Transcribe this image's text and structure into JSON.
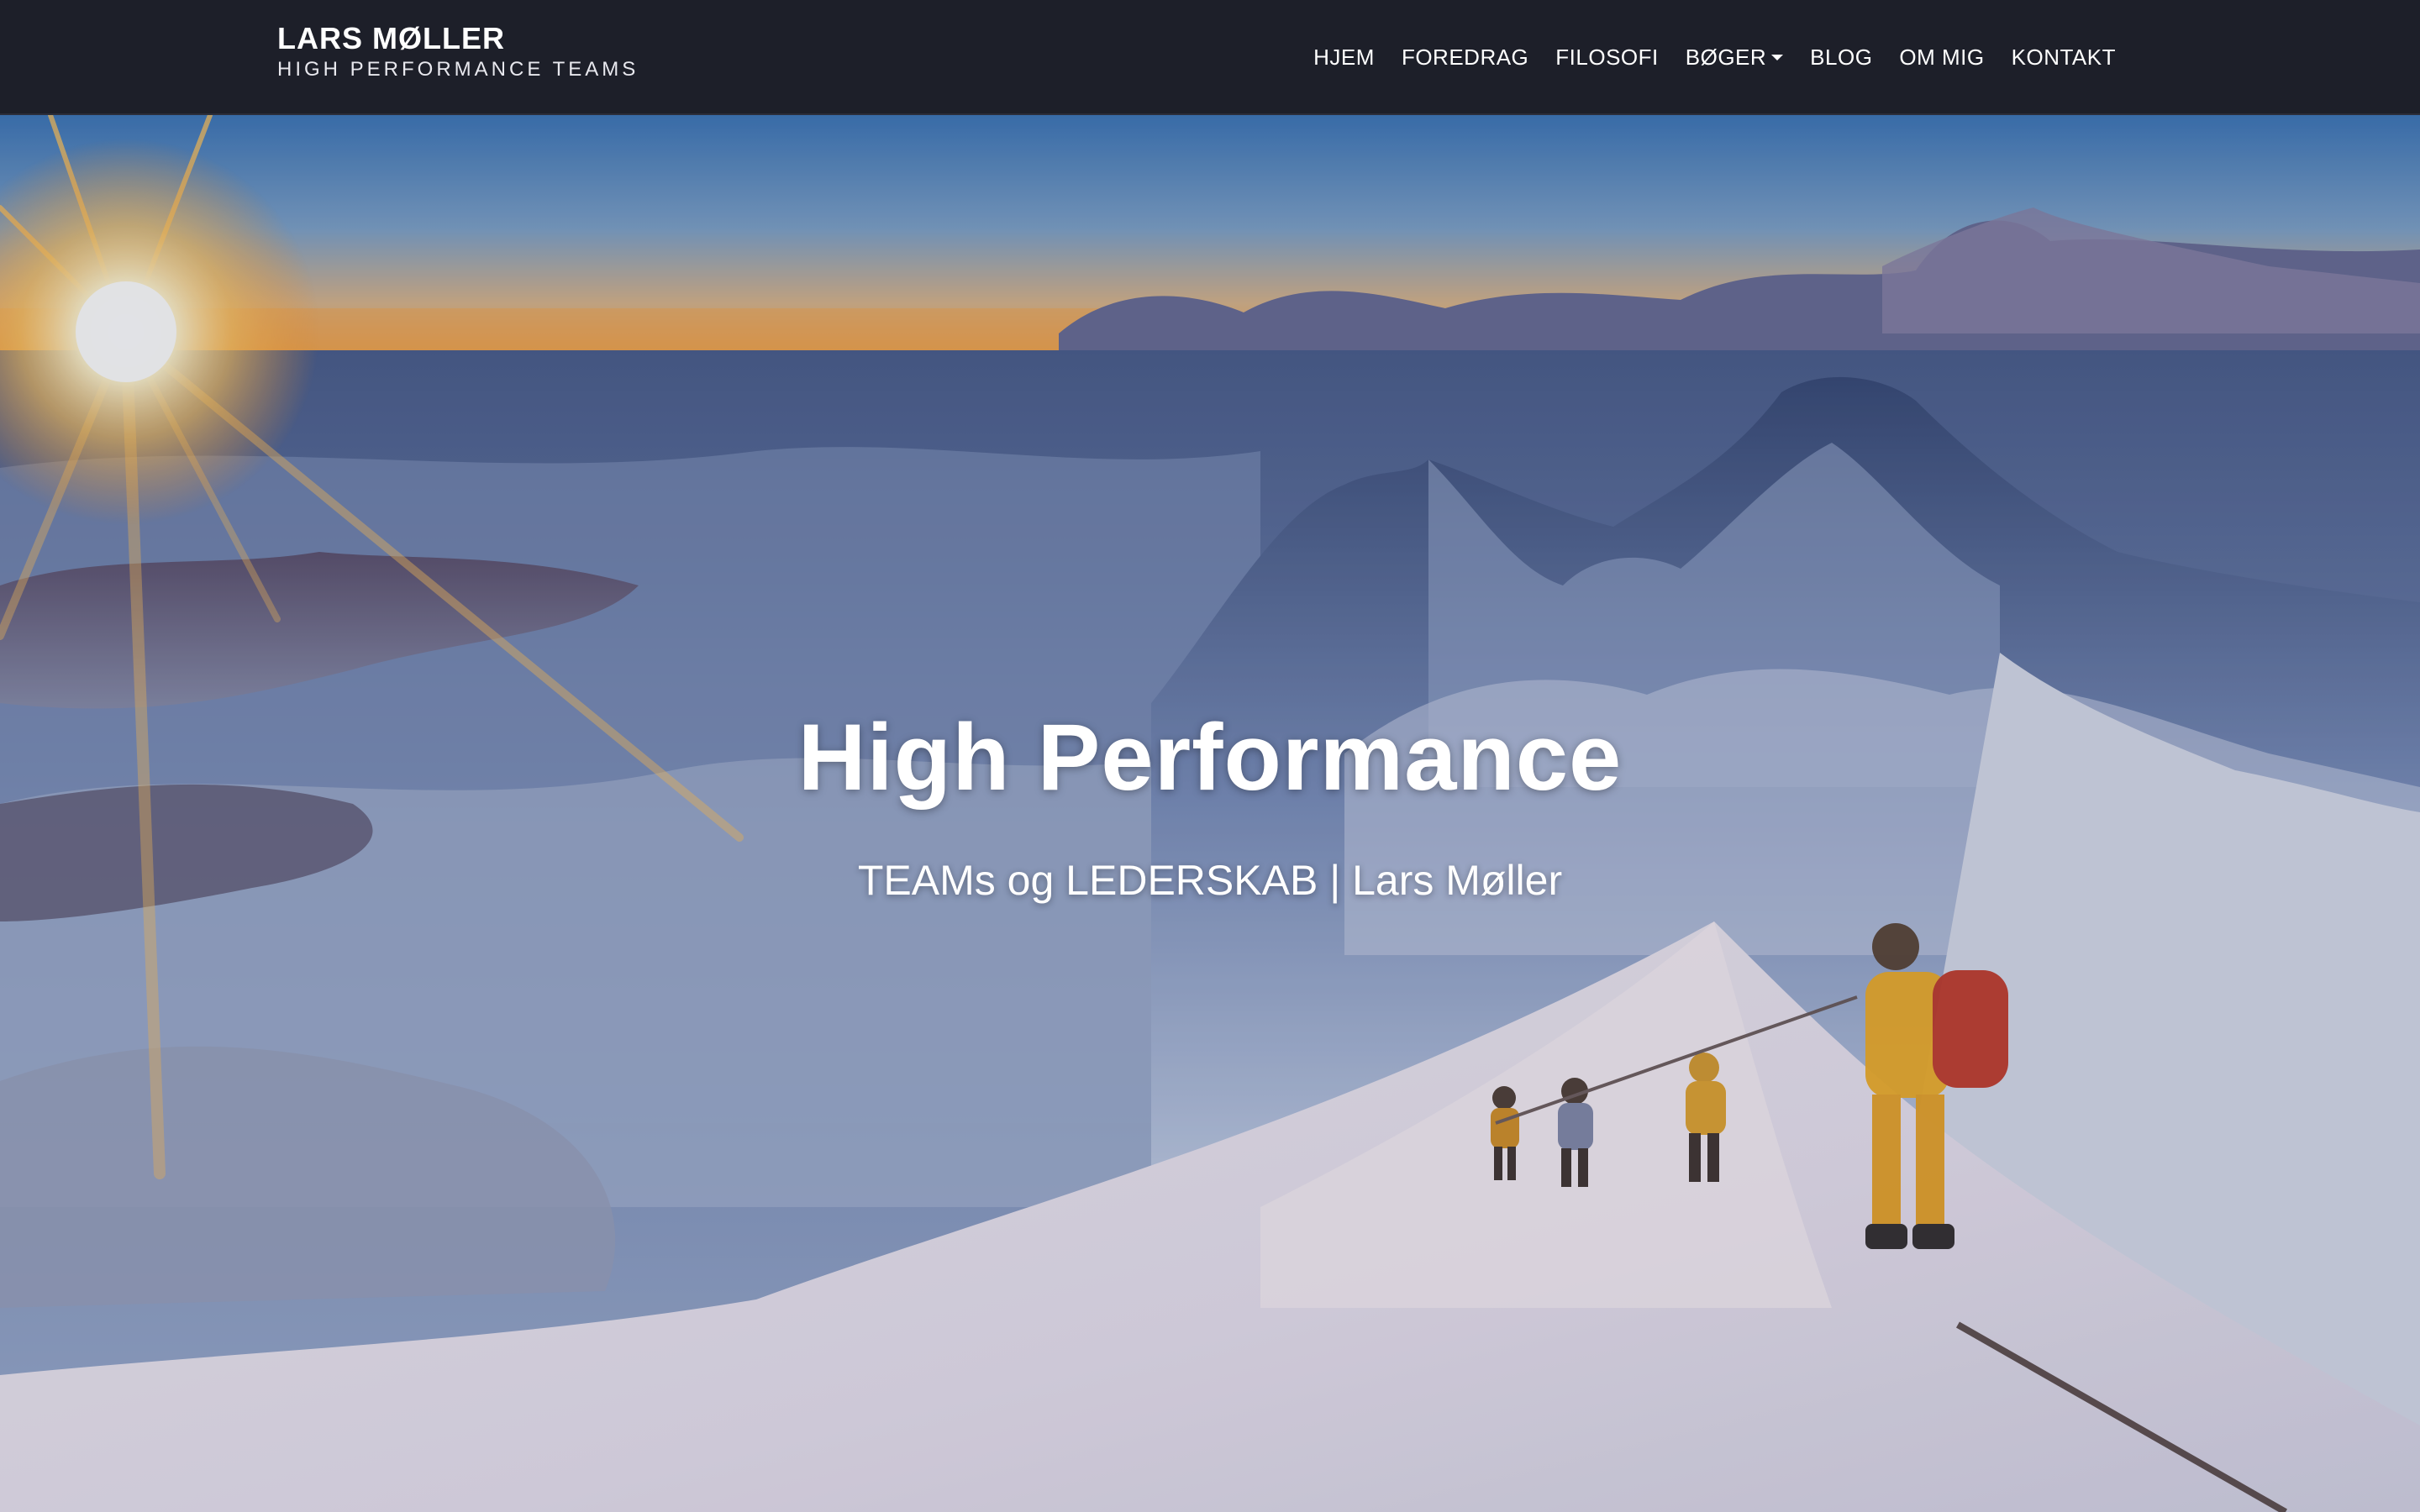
{
  "brand": {
    "name": "LARS MØLLER",
    "tagline": "HIGH PERFORMANCE TEAMS"
  },
  "nav": {
    "items": [
      {
        "label": "HJEM"
      },
      {
        "label": "FOREDRAG"
      },
      {
        "label": "FILOSOFI"
      },
      {
        "label": "BØGER"
      },
      {
        "label": "BLOG"
      },
      {
        "label": "OM MIG"
      },
      {
        "label": "KONTAKT"
      }
    ]
  },
  "hero": {
    "title": "High Performance",
    "subtitle": "TEAMs og LEDERSKAB | Lars Møller",
    "background_icon": "mountain-summit-sunrise-photo"
  },
  "colors": {
    "navbar_bg": "#1d1f29",
    "text": "#ffffff"
  }
}
